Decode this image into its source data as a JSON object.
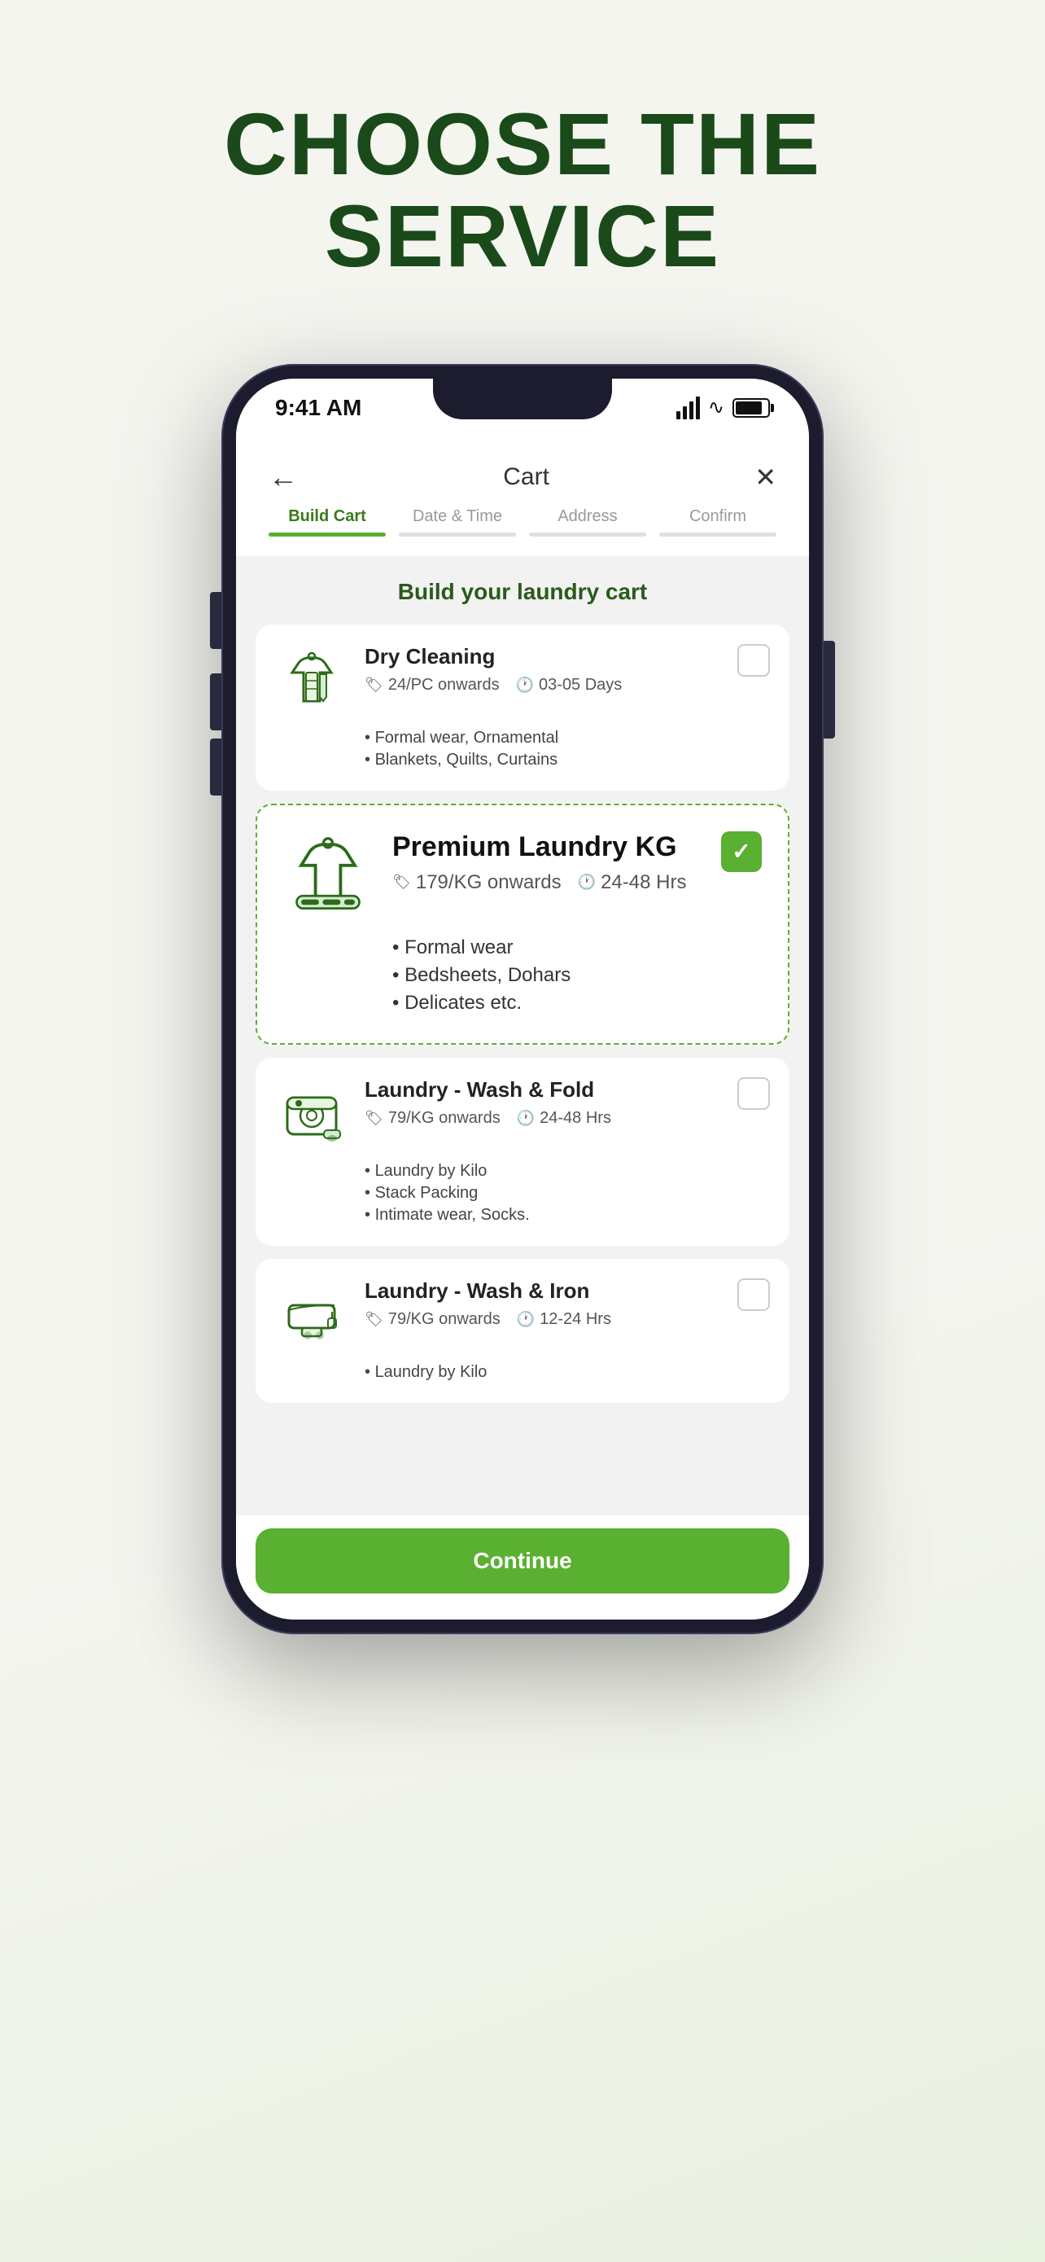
{
  "page": {
    "title_line1": "CHOOSE THE",
    "title_line2": "SERVICE"
  },
  "status_bar": {
    "time": "9:41 AM"
  },
  "header": {
    "title": "Cart",
    "back_label": "←",
    "close_label": "✕"
  },
  "steps": [
    {
      "label": "Build Cart",
      "active": true
    },
    {
      "label": "Date & Time",
      "active": false
    },
    {
      "label": "Address",
      "active": false
    },
    {
      "label": "Confirm",
      "active": false
    }
  ],
  "cart_subtitle": "Build your laundry cart",
  "services": [
    {
      "name": "Dry Cleaning",
      "price": "24/PC onwards",
      "time": "03-05 Days",
      "features": [
        "Formal wear, Ornamental",
        "Blankets, Quilts, Curtains"
      ],
      "selected": false
    },
    {
      "name": "Premium Laundry KG",
      "price": "179/KG onwards",
      "time": "24-48 Hrs",
      "features": [
        "Formal wear",
        "Bedsheets, Dohars",
        "Delicates etc."
      ],
      "selected": true,
      "premium": true
    },
    {
      "name": "Laundry - Wash & Fold",
      "price": "79/KG onwards",
      "time": "24-48 Hrs",
      "features": [
        "Laundry by Kilo",
        "Stack Packing",
        "Intimate wear, Socks."
      ],
      "selected": false
    },
    {
      "name": "Laundry - Wash & Iron",
      "price": "79/KG onwards",
      "time": "12-24 Hrs",
      "features": [
        "Laundry by Kilo"
      ],
      "selected": false
    }
  ],
  "continue_button": "Continue"
}
